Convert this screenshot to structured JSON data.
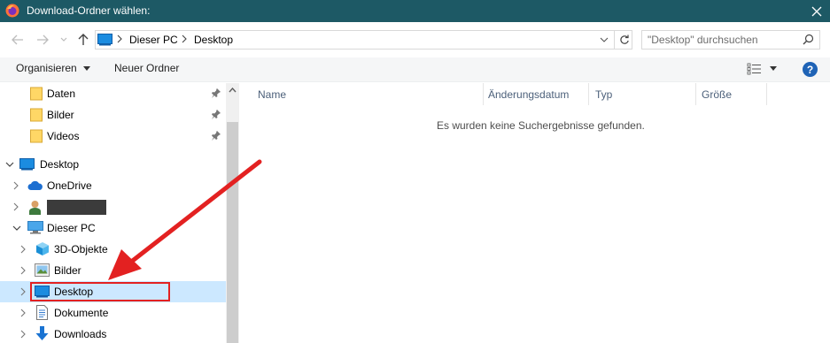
{
  "window": {
    "title": "Download-Ordner wählen:"
  },
  "address": {
    "crumbs": [
      "Dieser PC",
      "Desktop"
    ]
  },
  "search": {
    "placeholder": "\"Desktop\" durchsuchen"
  },
  "toolbar": {
    "organize_label": "Organisieren",
    "new_folder_label": "Neuer Ordner",
    "help_label": "?"
  },
  "nav": {
    "quick": [
      {
        "label": "Daten"
      },
      {
        "label": "Bilder"
      },
      {
        "label": "Videos"
      }
    ],
    "desktop_root": "Desktop",
    "onedrive": "OneDrive",
    "this_pc": "Dieser PC",
    "pc_children": [
      {
        "label": "3D-Objekte"
      },
      {
        "label": "Bilder"
      },
      {
        "label": "Desktop"
      },
      {
        "label": "Dokumente"
      },
      {
        "label": "Downloads"
      }
    ]
  },
  "columns": [
    "Name",
    "Änderungsdatum",
    "Typ",
    "Größe"
  ],
  "content": {
    "empty_message": "Es wurden keine Suchergebnisse gefunden."
  },
  "colors": {
    "titlebar": "#1d5965",
    "selection": "#cce8ff",
    "annotation": "#e32121"
  }
}
